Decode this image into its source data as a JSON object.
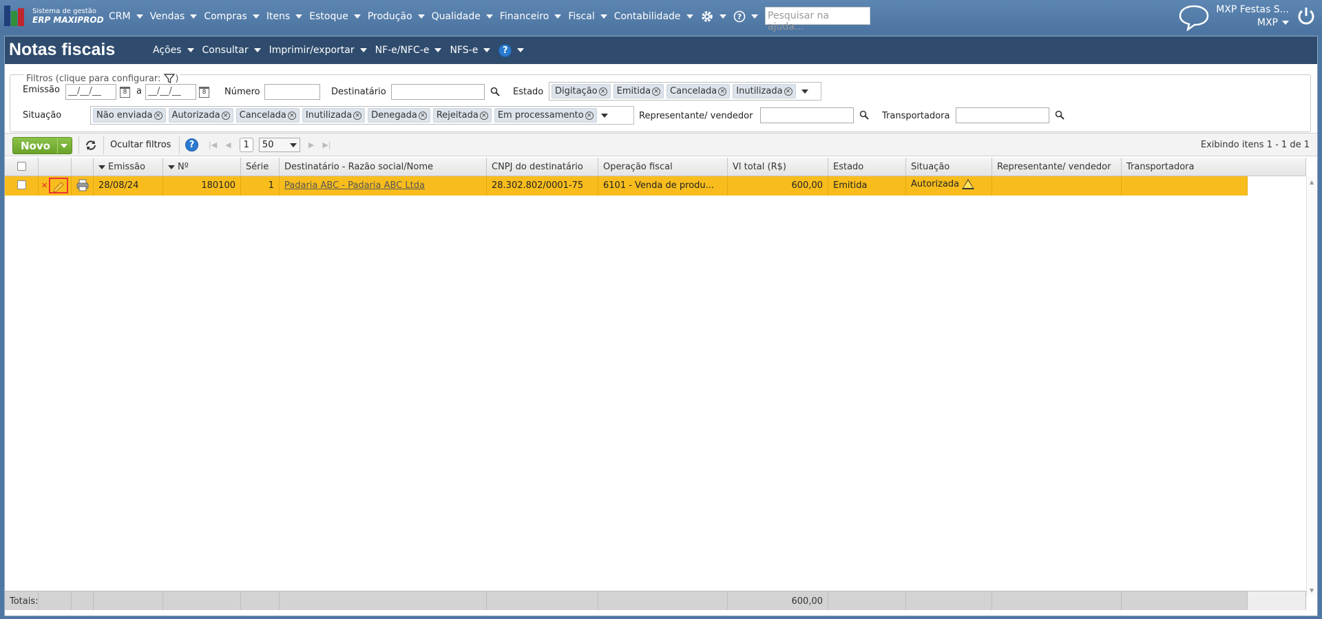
{
  "app": {
    "logo_line1": "Sistema de gestão",
    "logo_line2": "ERP MAXIPROD",
    "menu": [
      "CRM",
      "Vendas",
      "Compras",
      "Itens",
      "Estoque",
      "Produção",
      "Qualidade",
      "Financeiro",
      "Fiscal",
      "Contabilidade"
    ],
    "help_search_placeholder": "Pesquisar na ajuda...",
    "user_company": "MXP Festas S...",
    "user_short": "MXP"
  },
  "page": {
    "title": "Notas fiscais",
    "menu": [
      "Ações",
      "Consultar",
      "Imprimir/exportar",
      "NF-e/NFC-e",
      "NFS-e"
    ]
  },
  "filters": {
    "legend": "Filtros (clique para configurar:",
    "legend_close": ")",
    "emissao_label": "Emissão",
    "date_mask": "__/__/__",
    "a_label": "a",
    "numero_label": "Número",
    "destinatario_label": "Destinatário",
    "estado_label": "Estado",
    "estado_tags": [
      "Digitação",
      "Emitida",
      "Cancelada",
      "Inutilizada"
    ],
    "situacao_label": "Situação",
    "situacao_tags": [
      "Não enviada",
      "Autorizada",
      "Cancelada",
      "Inutilizada",
      "Denegada",
      "Rejeitada",
      "Em processamento"
    ],
    "representante_label": "Representante/ vendedor",
    "transportadora_label": "Transportadora"
  },
  "toolbar": {
    "novo_label": "Novo",
    "ocultar_filtros": "Ocultar filtros",
    "page_number": "1",
    "page_size": "50",
    "exibindo": "Exibindo itens 1 - 1 de 1"
  },
  "grid": {
    "headers": {
      "emissao": "Emissão",
      "numero": "Nº",
      "serie": "Série",
      "destinatario": "Destinatário - Razão social/Nome",
      "cnpj": "CNPJ do destinatário",
      "operacao": "Operação fiscal",
      "vl_total": "Vl total (R$)",
      "estado": "Estado",
      "situacao": "Situação",
      "representante": "Representante/ vendedor",
      "transportadora": "Transportadora"
    },
    "rows": [
      {
        "emissao": "28/08/24",
        "numero": "180100",
        "serie": "1",
        "destinatario": "Padaria ABC - Padaria ABC Ltda",
        "cnpj": "28.302.802/0001-75",
        "operacao": "6101 - Venda de produ...",
        "vl_total": "600,00",
        "estado": "Emitida",
        "situacao": "Autorizada"
      }
    ],
    "totals_label": "Totais:",
    "totals_vl": "600,00"
  },
  "colors": {
    "topbar": "#4e77a3",
    "title_bar": "#2f4c6e",
    "row_selected": "#f8bd1d",
    "novo_button": "#7ab336"
  }
}
